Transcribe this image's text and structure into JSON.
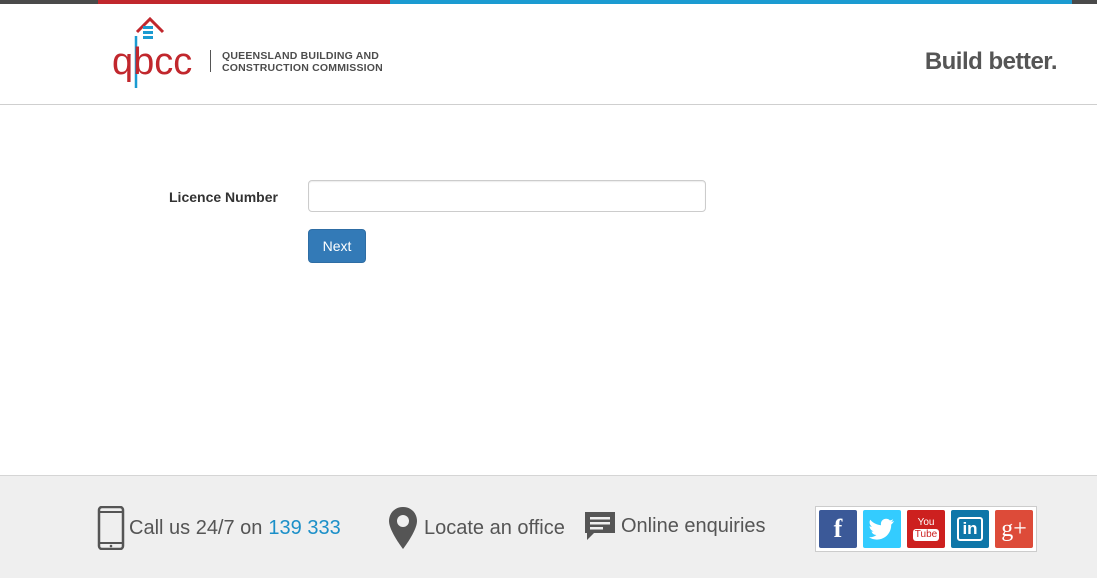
{
  "header": {
    "logo_letters": "qbcc",
    "org_line1": "QUEENSLAND BUILDING AND",
    "org_line2": "CONSTRUCTION COMMISSION",
    "tagline": "Build better."
  },
  "form": {
    "licence_label": "Licence Number",
    "licence_value": "",
    "next_label": "Next"
  },
  "footer": {
    "call_prefix": "Call us 24/7 on",
    "call_number": "139 333",
    "locate": "Locate an office",
    "enquiries": "Online enquiries",
    "social": {
      "facebook_glyph": "f",
      "youtube_you": "You",
      "youtube_tube": "Tube",
      "linkedin_glyph": "in",
      "googleplus_glyph": "g+"
    }
  },
  "colors": {
    "brand_red": "#c1272d",
    "brand_blue": "#1b9bd1",
    "button_blue": "#337ab7",
    "facebook": "#3b5998",
    "twitter": "#33ccff",
    "youtube": "#cd201f",
    "linkedin": "#0e76a8",
    "googleplus": "#dd4b39"
  }
}
